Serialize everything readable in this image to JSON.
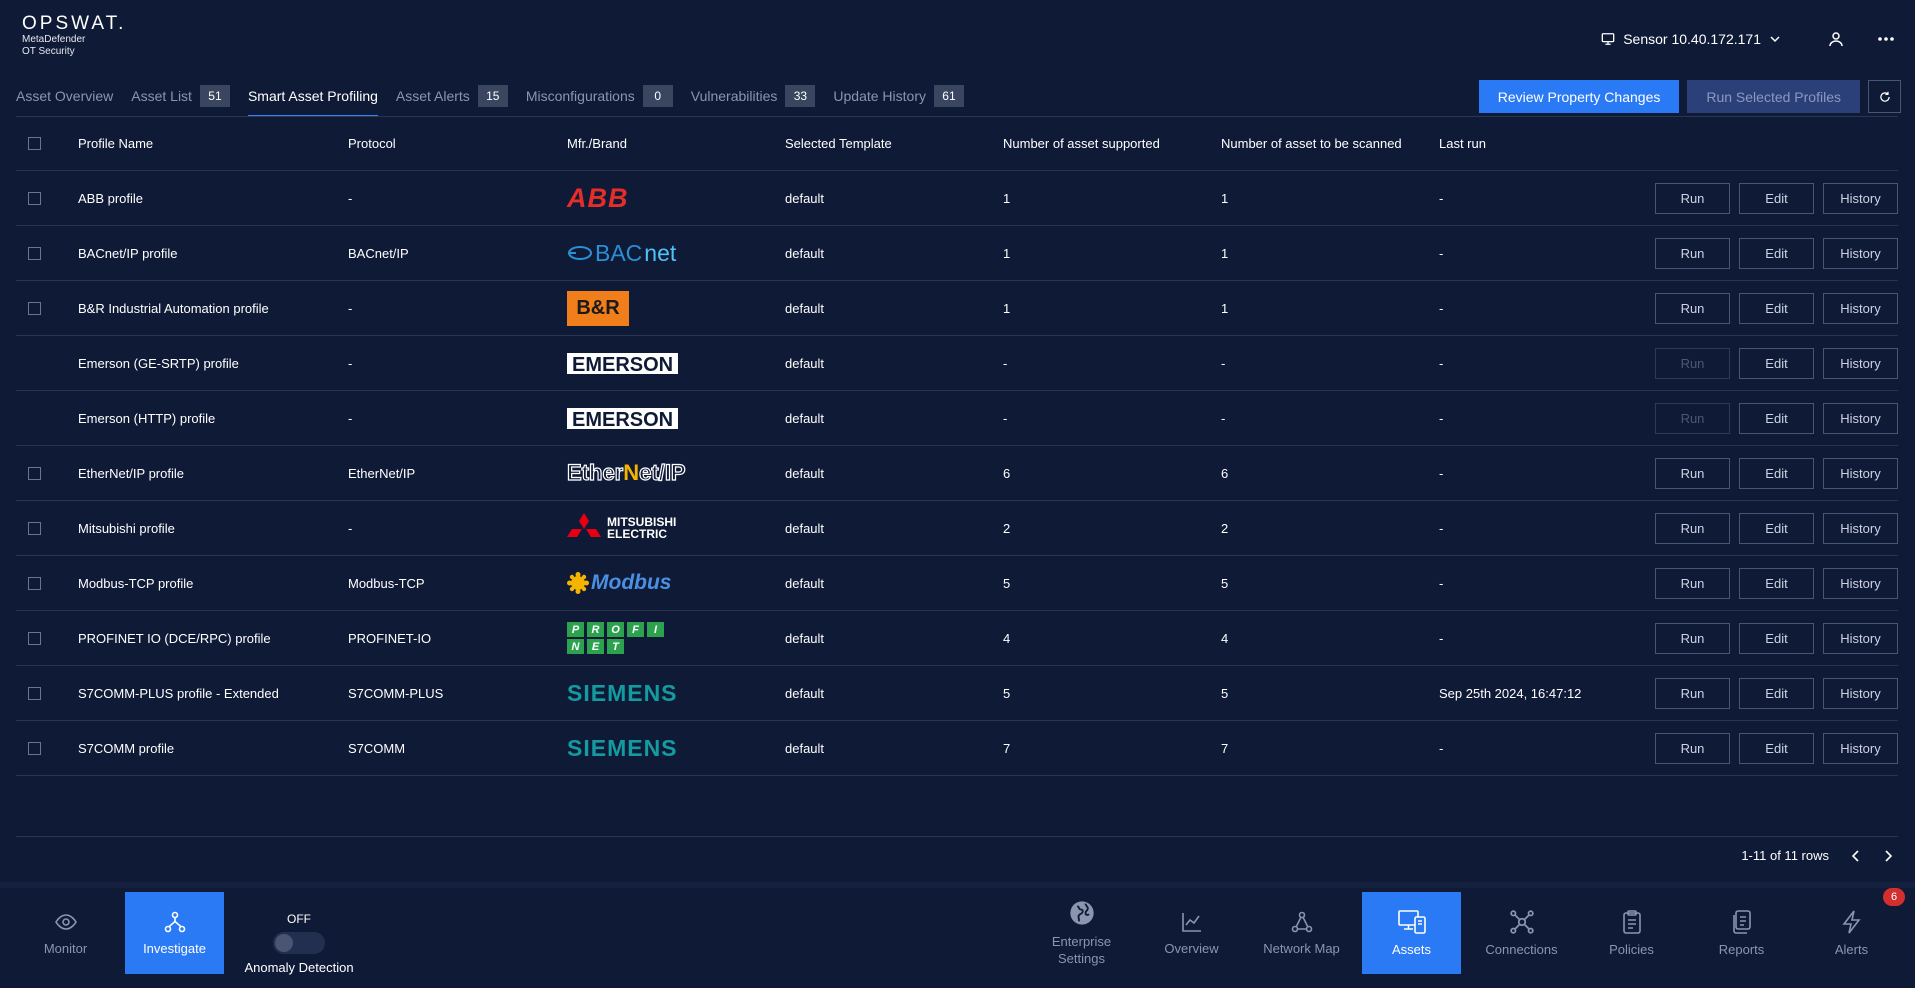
{
  "header": {
    "logo_word": "OPSWAT.",
    "logo_line1": "MetaDefender",
    "logo_line2": "OT Security",
    "sensor_label": "Sensor 10.40.172.171"
  },
  "tabs": [
    {
      "label": "Asset Overview",
      "count": ""
    },
    {
      "label": "Asset List",
      "count": "51"
    },
    {
      "label": "Smart Asset Profiling",
      "count": ""
    },
    {
      "label": "Asset Alerts",
      "count": "15"
    },
    {
      "label": "Misconfigurations",
      "count": "0"
    },
    {
      "label": "Vulnerabilities",
      "count": "33"
    },
    {
      "label": "Update History",
      "count": "61"
    }
  ],
  "active_tab": "Smart Asset Profiling",
  "actions": {
    "review": "Review Property Changes",
    "run_selected": "Run Selected Profiles"
  },
  "columns": {
    "name": "Profile Name",
    "protocol": "Protocol",
    "brand": "Mfr./Brand",
    "template": "Selected Template",
    "supported": "Number of asset supported",
    "scanned": "Number of asset to be scanned",
    "last_run": "Last run"
  },
  "row_actions": {
    "run": "Run",
    "edit": "Edit",
    "history": "History"
  },
  "logos": {
    "abb": "ABB",
    "bacnet_a": "BAC",
    "bacnet_b": "net",
    "br": "B&R",
    "emerson": "EMERSON",
    "eip_a": "Ether",
    "eip_b": "N",
    "eip_c": "et/IP",
    "mits_1": "MITSUBISHI",
    "mits_2": "ELECTRIC",
    "modbus": "Modbus",
    "profi_1": [
      "P",
      "R",
      "O",
      "F",
      "I"
    ],
    "profi_2": [
      "N",
      "E",
      "T"
    ],
    "siemens": "SIEMENS"
  },
  "rows": [
    {
      "name": "ABB profile",
      "protocol": "-",
      "brand": "abb",
      "template": "default",
      "supported": "1",
      "scanned": "1",
      "last_run": "-",
      "checkbox": true,
      "run_enabled": true
    },
    {
      "name": "BACnet/IP profile",
      "protocol": "BACnet/IP",
      "brand": "bacnet",
      "template": "default",
      "supported": "1",
      "scanned": "1",
      "last_run": "-",
      "checkbox": true,
      "run_enabled": true
    },
    {
      "name": "B&R Industrial Automation profile",
      "protocol": "-",
      "brand": "br",
      "template": "default",
      "supported": "1",
      "scanned": "1",
      "last_run": "-",
      "checkbox": true,
      "run_enabled": true
    },
    {
      "name": "Emerson (GE-SRTP) profile",
      "protocol": "-",
      "brand": "emerson",
      "template": "default",
      "supported": "-",
      "scanned": "-",
      "last_run": "-",
      "checkbox": false,
      "run_enabled": false
    },
    {
      "name": "Emerson (HTTP) profile",
      "protocol": "-",
      "brand": "emerson",
      "template": "default",
      "supported": "-",
      "scanned": "-",
      "last_run": "-",
      "checkbox": false,
      "run_enabled": false
    },
    {
      "name": "EtherNet/IP profile",
      "protocol": "EtherNet/IP",
      "brand": "eip",
      "template": "default",
      "supported": "6",
      "scanned": "6",
      "last_run": "-",
      "checkbox": true,
      "run_enabled": true
    },
    {
      "name": "Mitsubishi profile",
      "protocol": "-",
      "brand": "mitsubishi",
      "template": "default",
      "supported": "2",
      "scanned": "2",
      "last_run": "-",
      "checkbox": true,
      "run_enabled": true
    },
    {
      "name": "Modbus-TCP profile",
      "protocol": "Modbus-TCP",
      "brand": "modbus",
      "template": "default",
      "supported": "5",
      "scanned": "5",
      "last_run": "-",
      "checkbox": true,
      "run_enabled": true
    },
    {
      "name": "PROFINET IO (DCE/RPC) profile",
      "protocol": "PROFINET-IO",
      "brand": "profinet",
      "template": "default",
      "supported": "4",
      "scanned": "4",
      "last_run": "-",
      "checkbox": true,
      "run_enabled": true
    },
    {
      "name": "S7COMM-PLUS profile - Extended",
      "protocol": "S7COMM-PLUS",
      "brand": "siemens",
      "template": "default",
      "supported": "5",
      "scanned": "5",
      "last_run": "Sep 25th 2024, 16:47:12",
      "checkbox": true,
      "run_enabled": true
    },
    {
      "name": "S7COMM profile",
      "protocol": "S7COMM",
      "brand": "siemens",
      "template": "default",
      "supported": "7",
      "scanned": "7",
      "last_run": "-",
      "checkbox": true,
      "run_enabled": true
    }
  ],
  "pager": {
    "label": "1-11 of 11 rows"
  },
  "bottom_nav": {
    "left": [
      {
        "key": "monitor",
        "label": "Monitor",
        "active": false
      },
      {
        "key": "investigate",
        "label": "Investigate",
        "active": true
      }
    ],
    "anomaly": {
      "state": "OFF",
      "label": "Anomaly Detection"
    },
    "right": [
      {
        "key": "enterprise",
        "label_1": "Enterprise",
        "label_2": "Settings",
        "active": false
      },
      {
        "key": "overview",
        "label_1": "Overview",
        "active": false
      },
      {
        "key": "network",
        "label_1": "Network Map",
        "active": false
      },
      {
        "key": "assets",
        "label_1": "Assets",
        "active": true
      },
      {
        "key": "connections",
        "label_1": "Connections",
        "active": false
      },
      {
        "key": "policies",
        "label_1": "Policies",
        "active": false
      },
      {
        "key": "reports",
        "label_1": "Reports",
        "active": false
      },
      {
        "key": "alerts",
        "label_1": "Alerts",
        "active": false
      }
    ],
    "alerts_count": "6"
  },
  "colors": {
    "background": "#0f1a36",
    "accent": "#2a7af5",
    "row_divider": "#2a3552",
    "muted_text": "#8b95ad",
    "alert_badge": "#d32f2f"
  }
}
